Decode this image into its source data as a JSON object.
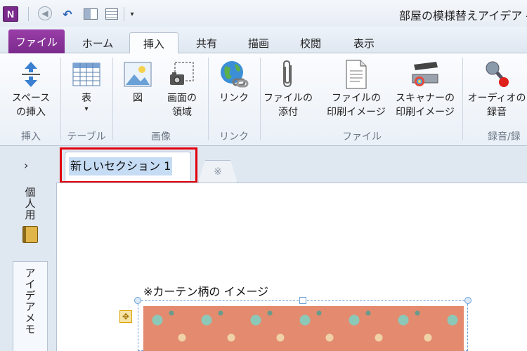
{
  "window": {
    "app_logo": "N",
    "title": "部屋の模様替えアイデア -",
    "quick_access": {
      "back_icon": "back-arrow-icon",
      "undo_icon": "undo-icon",
      "dock_icon": "dock-to-desktop-icon",
      "page_icon": "full-page-view-icon",
      "more": "▾"
    }
  },
  "ribbon_tabs": [
    "ファイル",
    "ホーム",
    "挿入",
    "共有",
    "描画",
    "校閲",
    "表示"
  ],
  "active_tab": "挿入",
  "ribbon": {
    "space": "スペース\nの挿入",
    "table": "表",
    "table_arrow": "▾",
    "picture": "図",
    "screen_clip": "画面の\n領域",
    "link": "リンク",
    "attach": "ファイルの\n添付",
    "printout": "ファイルの\n印刷イメージ",
    "scanner": "スキャナーの\n印刷イメージ",
    "audio": "オーディオの\n録音",
    "groups": {
      "insert": "挿入",
      "tables": "テーブル",
      "images": "画像",
      "links": "リンク",
      "files": "ファイル",
      "recording": "録音/録"
    }
  },
  "workspace": {
    "nav_toggle": "›",
    "section_tab": "新しいセクション 1",
    "add_section_icon": "※",
    "notebooks": [
      "個人用",
      "アイデアメモ"
    ]
  },
  "page": {
    "note_title": "※カーテン柄の イメージ",
    "move_handle_icon": "✥"
  },
  "colors": {
    "file_tab": "#7a2a8c",
    "highlight": "#e0000d",
    "selection": "#c6dcf4"
  }
}
